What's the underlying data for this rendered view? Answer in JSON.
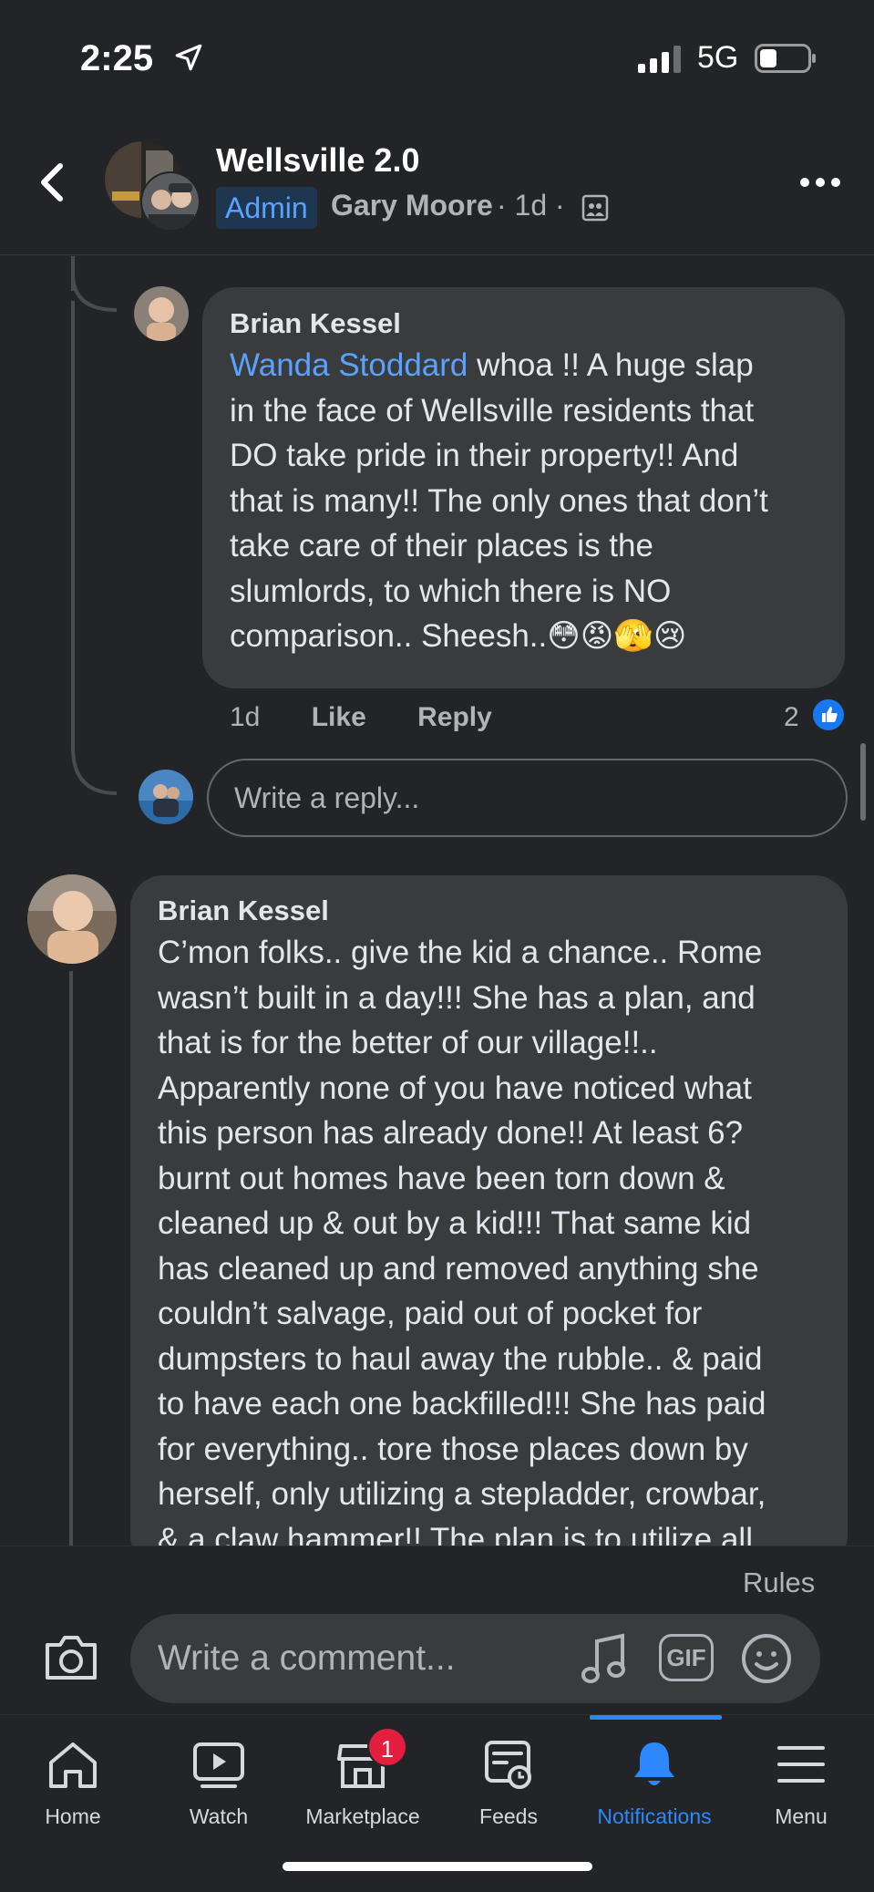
{
  "status_bar": {
    "time": "2:25",
    "network": "5G"
  },
  "header": {
    "group_name": "Wellsville 2.0",
    "badge": "Admin",
    "poster": "Gary Moore",
    "meta": "· 1d ·",
    "icons": [
      "back-chevron-icon",
      "privacy-members-icon",
      "more-icon"
    ]
  },
  "comments": [
    {
      "author": "Brian Kessel",
      "mention": "Wanda Stoddard",
      "text_lines": [
        "whoa !! A huge slap",
        "in the face of Wellsville residents that",
        "DO take pride in their property!! And",
        "that is many!! The only ones that don’t",
        "take care of their places is the",
        "slumlords, to which there is NO",
        "comparison.. Sheesh.."
      ],
      "emojis": [
        "😳",
        "😡",
        "🫣",
        "😢"
      ],
      "time": "1d",
      "like_label": "Like",
      "reply_label": "Reply",
      "reaction_count": "2"
    },
    {
      "author": "Brian Kessel",
      "text_lines": [
        "C’mon folks.. give the kid a chance.. Rome",
        "wasn’t built in a day!!! She has a plan, and",
        "that is for the better of our village!!..",
        "Apparently none of you have noticed what",
        "this person has already done!! At least 6?",
        "burnt out homes have been torn down &",
        "cleaned up & out by  a kid!!! That same kid",
        "has cleaned up and removed anything she",
        "couldn’t salvage, paid out of pocket for",
        "dumpsters to haul away the rubble.. & paid",
        "to have each one backfilled!!! She has paid",
        "for everything.. tore those places down by",
        "herself, only utilizing a stepladder, crowbar,",
        "& a claw hammer!! The plan is to utilize all"
      ]
    }
  ],
  "reply_box": {
    "placeholder": "Write a reply..."
  },
  "composer": {
    "rules_label": "Rules",
    "placeholder": "Write a comment...",
    "gif_label": "GIF"
  },
  "tabs": [
    {
      "label": "Home",
      "icon": "home-icon"
    },
    {
      "label": "Watch",
      "icon": "watch-icon"
    },
    {
      "label": "Marketplace",
      "icon": "marketplace-icon",
      "badge": "1"
    },
    {
      "label": "Feeds",
      "icon": "feeds-icon"
    },
    {
      "label": "Notifications",
      "icon": "bell-icon",
      "active": true
    },
    {
      "label": "Menu",
      "icon": "menu-icon"
    }
  ],
  "colors": {
    "background": "#232427",
    "bubble": "#3a3b3c",
    "accent": "#2d88ff",
    "mention": "#5aa2ff",
    "badge": "#e41e3f"
  }
}
